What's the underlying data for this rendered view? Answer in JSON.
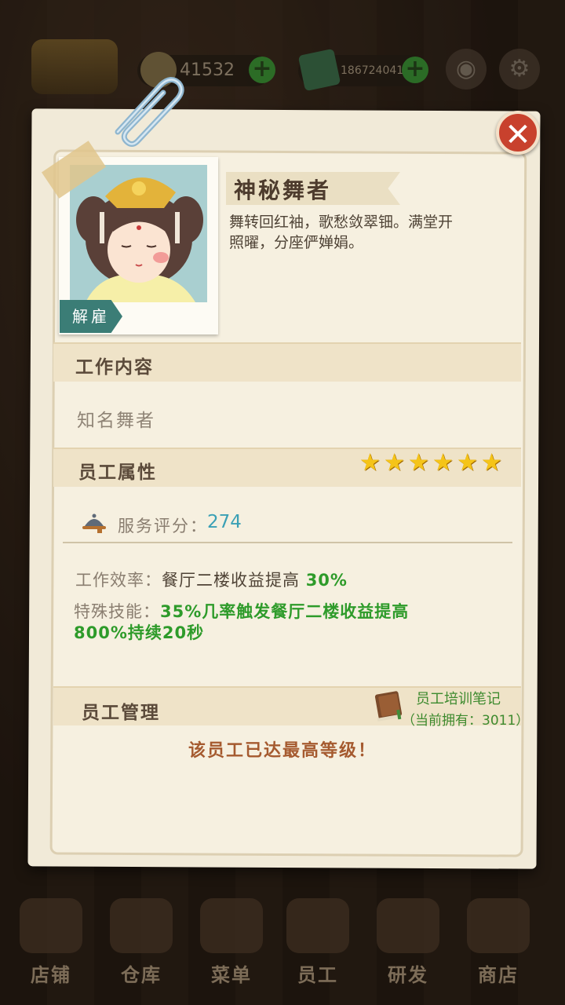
{
  "topbar": {
    "coins": "41532",
    "cash": "186724041"
  },
  "employee": {
    "name": "神秘舞者",
    "description": "舞转回红袖，歌愁敛翠钿。满堂开照曜，分座俨婵娟。",
    "dismiss_label": "解雇"
  },
  "sections": {
    "work_content": "工作内容",
    "attributes": "员工属性",
    "management": "员工管理"
  },
  "job_title": "知名舞者",
  "stars": [
    "★",
    "★",
    "★",
    "★",
    "★",
    "★"
  ],
  "service": {
    "label": "服务评分：",
    "value": "274"
  },
  "efficiency": {
    "label": "工作效率：",
    "text": "餐厅二楼收益提高 ",
    "value": "30%"
  },
  "skill": {
    "label": "特殊技能：",
    "text": "35%几率触发餐厅二楼收益提高800%持续20秒"
  },
  "training": {
    "label": "员工培训笔记",
    "count": "（当前拥有：3011）"
  },
  "max_message": "该员工已达最高等级！",
  "close_symbol": "✕",
  "bottom_nav": [
    "店铺",
    "仓库",
    "菜单",
    "员工",
    "研发",
    "商店"
  ],
  "colors": {
    "accent_green": "#2e9b2a",
    "service_blue": "#3aa0b5",
    "close_red": "#c8412d",
    "dismiss_teal": "#3b7d76"
  }
}
